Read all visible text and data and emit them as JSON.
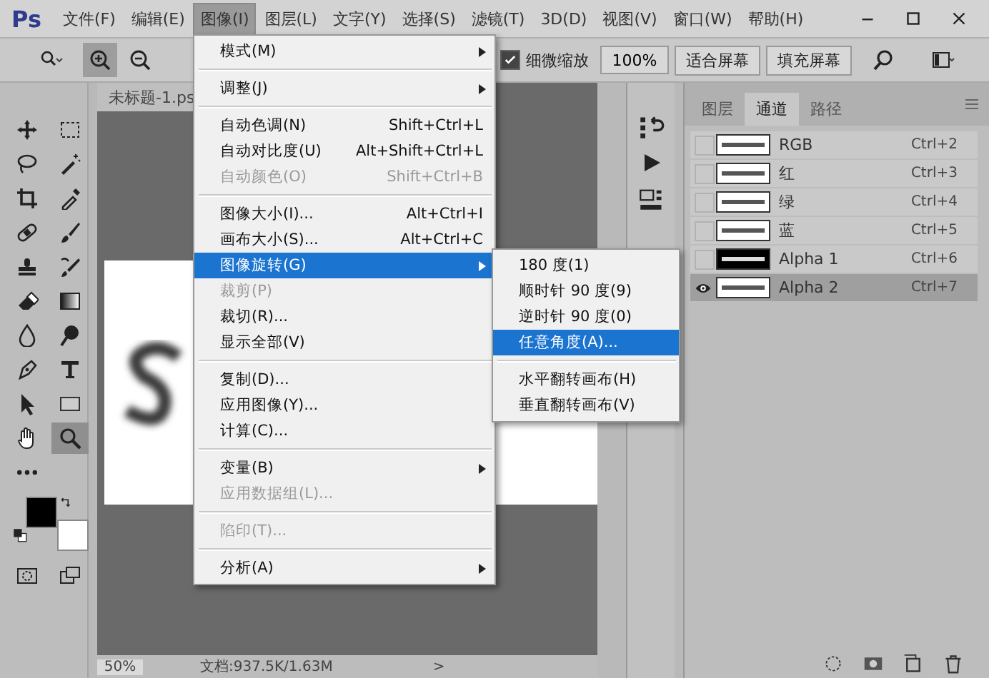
{
  "app": {
    "logo": "Ps"
  },
  "menubar": [
    {
      "label": "文件(F)",
      "selected": false
    },
    {
      "label": "编辑(E)",
      "selected": false
    },
    {
      "label": "图像(I)",
      "selected": true
    },
    {
      "label": "图层(L)",
      "selected": false
    },
    {
      "label": "文字(Y)",
      "selected": false
    },
    {
      "label": "选择(S)",
      "selected": false
    },
    {
      "label": "滤镜(T)",
      "selected": false
    },
    {
      "label": "3D(D)",
      "selected": false
    },
    {
      "label": "视图(V)",
      "selected": false
    },
    {
      "label": "窗口(W)",
      "selected": false
    },
    {
      "label": "帮助(H)",
      "selected": false
    }
  ],
  "options_bar": {
    "zoom_in_selected": true,
    "zoom_out_selected": false,
    "fine_zoom": {
      "label": "细微缩放",
      "checked": true
    },
    "zoom_field": {
      "value": "100%"
    },
    "buttons": [
      "适合屏幕",
      "填充屏幕"
    ]
  },
  "document": {
    "tab": "未标题-1.ps",
    "zoom": "50%",
    "info": "文档:937.5K/1.63M",
    "info_arrow": ">"
  },
  "tools": [
    {
      "kind": "cross-arrows",
      "selected": false
    },
    {
      "kind": "dashed-rect",
      "selected": false
    },
    {
      "kind": "lasso",
      "selected": false
    },
    {
      "kind": "wand",
      "selected": false
    },
    {
      "kind": "crop",
      "selected": false
    },
    {
      "kind": "eyedropper",
      "selected": false
    },
    {
      "kind": "bandage",
      "selected": false
    },
    {
      "kind": "brush",
      "selected": false
    },
    {
      "kind": "stamp",
      "selected": false
    },
    {
      "kind": "history-brush",
      "selected": false
    },
    {
      "kind": "eraser",
      "selected": false
    },
    {
      "kind": "gradient",
      "selected": false
    },
    {
      "kind": "drop",
      "selected": false
    },
    {
      "kind": "dodge",
      "selected": false
    },
    {
      "kind": "pen",
      "selected": false
    },
    {
      "kind": "type",
      "selected": false
    },
    {
      "kind": "pointer",
      "selected": false
    },
    {
      "kind": "rectangle",
      "selected": false
    },
    {
      "kind": "hand",
      "selected": false
    },
    {
      "kind": "zoom",
      "selected": true
    },
    {
      "kind": "dots",
      "selected": false
    }
  ],
  "image_menu": [
    {
      "kind": "item",
      "label": "模式(M)",
      "submenu": true,
      "disabled": false,
      "selected": false
    },
    {
      "kind": "separator"
    },
    {
      "kind": "item",
      "label": "调整(J)",
      "submenu": true,
      "disabled": false,
      "selected": false
    },
    {
      "kind": "separator"
    },
    {
      "kind": "item",
      "label": "自动色调(N)",
      "shortcut": "Shift+Ctrl+L",
      "disabled": false,
      "selected": false
    },
    {
      "kind": "item",
      "label": "自动对比度(U)",
      "shortcut": "Alt+Shift+Ctrl+L",
      "disabled": false,
      "selected": false
    },
    {
      "kind": "item",
      "label": "自动颜色(O)",
      "shortcut": "Shift+Ctrl+B",
      "disabled": true,
      "selected": false
    },
    {
      "kind": "separator"
    },
    {
      "kind": "item",
      "label": "图像大小(I)...",
      "shortcut": "Alt+Ctrl+I",
      "disabled": false,
      "selected": false
    },
    {
      "kind": "item",
      "label": "画布大小(S)...",
      "shortcut": "Alt+Ctrl+C",
      "disabled": false,
      "selected": false
    },
    {
      "kind": "item",
      "label": "图像旋转(G)",
      "submenu": true,
      "disabled": false,
      "selected": true
    },
    {
      "kind": "item",
      "label": "裁剪(P)",
      "disabled": true,
      "selected": false
    },
    {
      "kind": "item",
      "label": "裁切(R)...",
      "disabled": false,
      "selected": false
    },
    {
      "kind": "item",
      "label": "显示全部(V)",
      "disabled": false,
      "selected": false
    },
    {
      "kind": "separator"
    },
    {
      "kind": "item",
      "label": "复制(D)...",
      "disabled": false,
      "selected": false
    },
    {
      "kind": "item",
      "label": "应用图像(Y)...",
      "disabled": false,
      "selected": false
    },
    {
      "kind": "item",
      "label": "计算(C)...",
      "disabled": false,
      "selected": false
    },
    {
      "kind": "separator"
    },
    {
      "kind": "item",
      "label": "变量(B)",
      "submenu": true,
      "disabled": false,
      "selected": false
    },
    {
      "kind": "item",
      "label": "应用数据组(L)...",
      "disabled": true,
      "selected": false
    },
    {
      "kind": "separator"
    },
    {
      "kind": "item",
      "label": "陷印(T)...",
      "disabled": true,
      "selected": false
    },
    {
      "kind": "separator"
    },
    {
      "kind": "item",
      "label": "分析(A)",
      "submenu": true,
      "disabled": false,
      "selected": false
    }
  ],
  "rotate_submenu": [
    {
      "kind": "item",
      "label": "180 度(1)",
      "disabled": false,
      "selected": false
    },
    {
      "kind": "item",
      "label": "顺时针 90 度(9)",
      "disabled": false,
      "selected": false
    },
    {
      "kind": "item",
      "label": "逆时针 90 度(0)",
      "disabled": false,
      "selected": false
    },
    {
      "kind": "item",
      "label": "任意角度(A)...",
      "disabled": false,
      "selected": true
    },
    {
      "kind": "separator"
    },
    {
      "kind": "item",
      "label": "水平翻转画布(H)",
      "disabled": false,
      "selected": false
    },
    {
      "kind": "item",
      "label": "垂直翻转画布(V)",
      "disabled": false,
      "selected": false
    }
  ],
  "panel": {
    "tabs": [
      {
        "label": "图层",
        "selected": false
      },
      {
        "label": "通道",
        "selected": true
      },
      {
        "label": "路径",
        "selected": false
      }
    ],
    "channels": [
      {
        "name": "RGB",
        "shortcut": "Ctrl+2",
        "visible": false,
        "selected": false,
        "dark_thumbnail": false
      },
      {
        "name": "红",
        "shortcut": "Ctrl+3",
        "visible": false,
        "selected": false,
        "dark_thumbnail": false
      },
      {
        "name": "绿",
        "shortcut": "Ctrl+4",
        "visible": false,
        "selected": false,
        "dark_thumbnail": false
      },
      {
        "name": "蓝",
        "shortcut": "Ctrl+5",
        "visible": false,
        "selected": false,
        "dark_thumbnail": false
      },
      {
        "name": "Alpha 1",
        "shortcut": "Ctrl+6",
        "visible": false,
        "selected": false,
        "dark_thumbnail": true
      },
      {
        "name": "Alpha 2",
        "shortcut": "Ctrl+7",
        "visible": true,
        "selected": true,
        "dark_thumbnail": false
      }
    ]
  }
}
